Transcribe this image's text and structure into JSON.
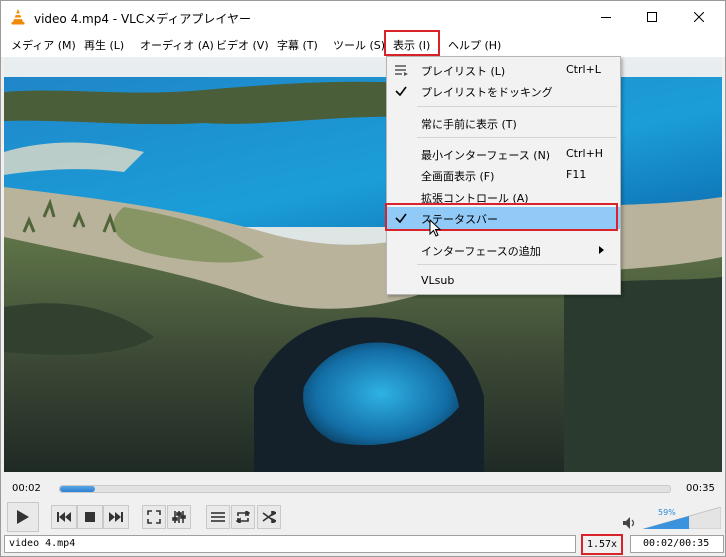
{
  "window": {
    "title": "video 4.mp4 - VLCメディアプレイヤー"
  },
  "menubar": [
    {
      "label": "メディア (M)"
    },
    {
      "label": "再生 (L)"
    },
    {
      "label": "オーディオ (A)"
    },
    {
      "label": "ビデオ (V)"
    },
    {
      "label": "字幕 (T)"
    },
    {
      "label": "ツール (S)"
    },
    {
      "label": "表示 (I)"
    },
    {
      "label": "ヘルプ (H)"
    }
  ],
  "view_menu": {
    "items": [
      {
        "label": "プレイリスト (L)",
        "shortcut": "Ctrl+L",
        "icon": "playlist-icon"
      },
      {
        "label": "プレイリストをドッキング",
        "checked": true
      },
      {
        "label": "常に手前に表示 (T)"
      },
      {
        "label": "最小インターフェース (N)",
        "shortcut": "Ctrl+H"
      },
      {
        "label": "全画面表示 (F)",
        "shortcut": "F11"
      },
      {
        "label": "拡張コントロール (A)"
      },
      {
        "label": "ステータスバー",
        "checked": true,
        "highlighted": true
      },
      {
        "label": "インターフェースの追加",
        "submenu": true
      },
      {
        "label": "VLsub"
      }
    ]
  },
  "player": {
    "elapsed": "00:02",
    "total": "00:35",
    "progress": 0.057,
    "volume_label": "59%",
    "volume": 0.59
  },
  "statusbar": {
    "filename": "video 4.mp4",
    "speed": "1.57x",
    "time": "00:02/00:35"
  },
  "colors": {
    "highlight_box": "#d9222a",
    "menu_hover": "#91c9f7",
    "seek_fill": "#2d7fd0"
  }
}
